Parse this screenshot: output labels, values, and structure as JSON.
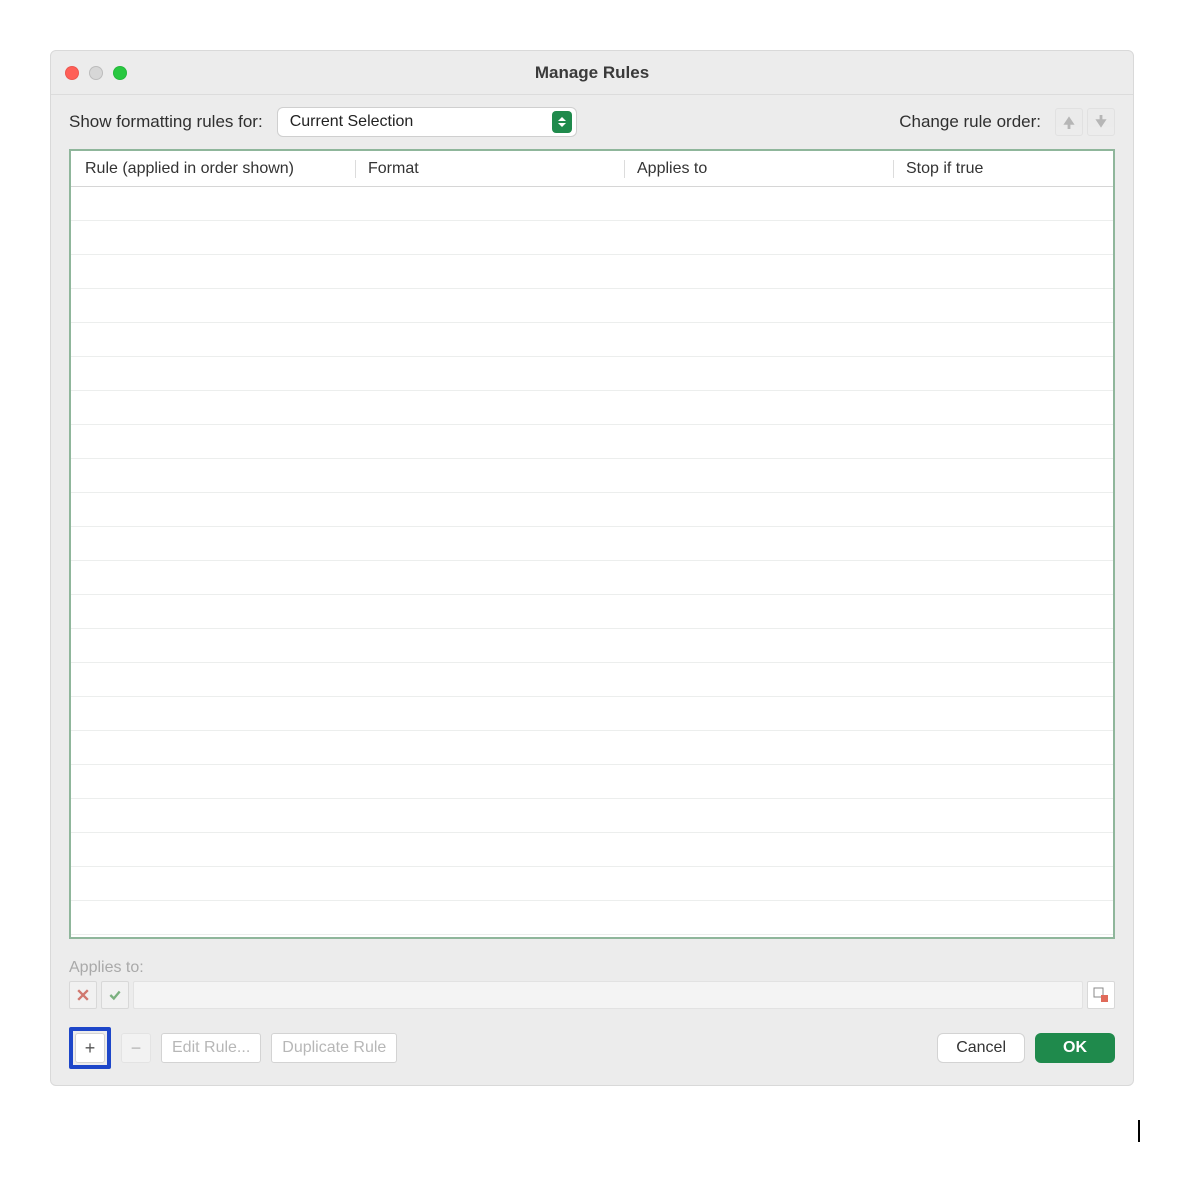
{
  "title": "Manage Rules",
  "toolbar": {
    "show_label": "Show formatting rules for:",
    "dropdown_value": "Current Selection",
    "order_label": "Change rule order:"
  },
  "columns": {
    "rule": "Rule (applied in order shown)",
    "format": "Format",
    "applies": "Applies to",
    "stop": "Stop if true"
  },
  "applies_to": {
    "label": "Applies to:",
    "value": ""
  },
  "footer": {
    "add": "+",
    "remove": "−",
    "edit": "Edit Rule...",
    "duplicate": "Duplicate Rule",
    "cancel": "Cancel",
    "ok": "OK"
  }
}
